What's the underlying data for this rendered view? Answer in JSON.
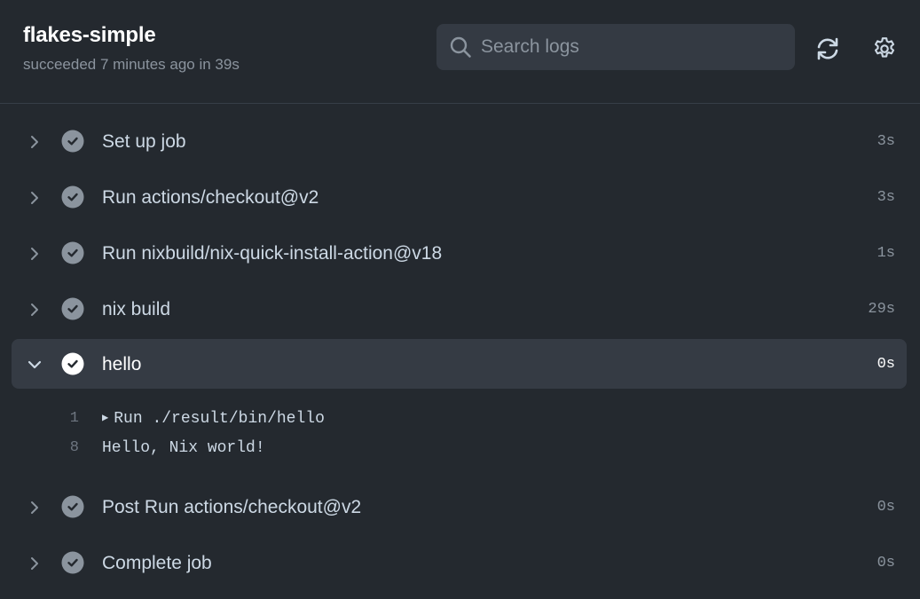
{
  "header": {
    "job_title": "flakes-simple",
    "job_status": "succeeded 7 minutes ago in 39s",
    "search": {
      "placeholder": "Search logs",
      "value": ""
    },
    "refresh_icon": "refresh-icon",
    "settings_icon": "gear-icon"
  },
  "steps": [
    {
      "name": "Set up job",
      "duration": "3s",
      "status": "success",
      "expanded": false
    },
    {
      "name": "Run actions/checkout@v2",
      "duration": "3s",
      "status": "success",
      "expanded": false
    },
    {
      "name": "Run nixbuild/nix-quick-install-action@v18",
      "duration": "1s",
      "status": "success",
      "expanded": false
    },
    {
      "name": "nix build",
      "duration": "29s",
      "status": "success",
      "expanded": false
    },
    {
      "name": "hello",
      "duration": "0s",
      "status": "success",
      "expanded": true
    },
    {
      "name": "Post Run actions/checkout@v2",
      "duration": "0s",
      "status": "success",
      "expanded": false
    },
    {
      "name": "Complete job",
      "duration": "0s",
      "status": "success",
      "expanded": false
    }
  ],
  "log": {
    "lines": [
      {
        "number": "1",
        "marker": "▶",
        "text": "Run ./result/bin/hello"
      },
      {
        "number": "8",
        "marker": "",
        "text": "Hello, Nix world!"
      }
    ]
  },
  "colors": {
    "background": "#24292f",
    "expanded_row": "#353b44",
    "muted_text": "#8b949e",
    "success_icon": "#8b949e"
  }
}
